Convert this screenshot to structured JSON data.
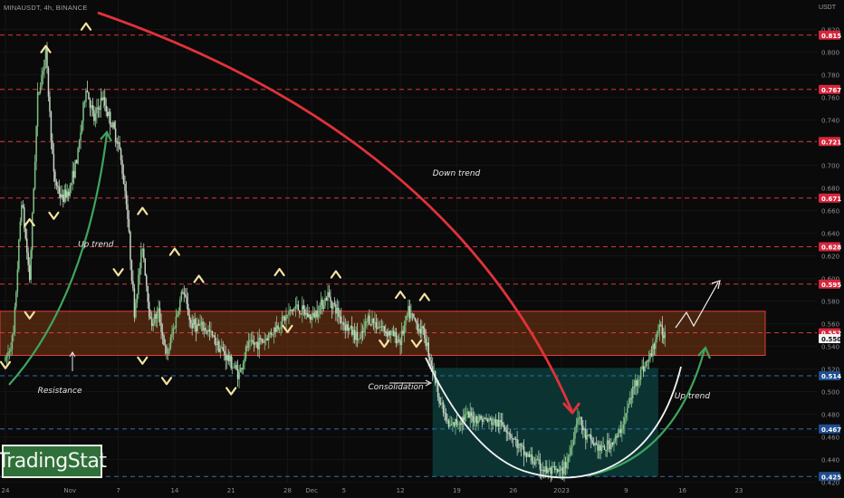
{
  "header": {
    "symbol": "MINAUSDT, 4h, BINANCE",
    "currency": "USDT"
  },
  "logo": {
    "text": "TradingStat"
  },
  "colors": {
    "background": "#0a0a0a",
    "candle_up": "#7fc185",
    "candle_down": "#c6d3c4",
    "resistance_dashed": "#d9383f",
    "support_dashed": "#2f6fb3",
    "zone_fill": "#7b3a14",
    "consolidation_fill": "#0c3b3a",
    "down_trend_arrow": "#e0323a",
    "up_trend_arrow": "#3fa55e",
    "pivot_marker": "#f3e3a2"
  },
  "chart_data": {
    "type": "candlestick",
    "title": "MINAUSDT, 4h, BINANCE",
    "y_unit": "USDT",
    "ylim": [
      0.418,
      0.826
    ],
    "y_ticks": [
      0.42,
      0.44,
      0.46,
      0.48,
      0.5,
      0.52,
      0.54,
      0.56,
      0.58,
      0.6,
      0.62,
      0.64,
      0.66,
      0.68,
      0.7,
      0.72,
      0.74,
      0.76,
      0.78,
      0.8,
      0.82
    ],
    "y_tick_labels": [
      "0.420",
      "0.440",
      "0.460",
      "0.480",
      "0.500",
      "0.520",
      "0.540",
      "0.560",
      "0.580",
      "0.600",
      "0.620",
      "0.640",
      "0.660",
      "0.680",
      "0.700",
      "0.720",
      "0.740",
      "0.760",
      "0.780",
      "0.800",
      "0.820"
    ],
    "x_range": [
      "2022-10-24",
      "2023-01-24"
    ],
    "x_ticks": [
      {
        "date": "2022-10-24",
        "label": "24"
      },
      {
        "date": "2022-11-01",
        "label": "Nov"
      },
      {
        "date": "2022-11-07",
        "label": "7"
      },
      {
        "date": "2022-11-14",
        "label": "14"
      },
      {
        "date": "2022-11-21",
        "label": "21"
      },
      {
        "date": "2022-11-28",
        "label": "28"
      },
      {
        "date": "2022-12-01",
        "label": "Dec"
      },
      {
        "date": "2022-12-05",
        "label": "5"
      },
      {
        "date": "2022-12-12",
        "label": "12"
      },
      {
        "date": "2022-12-19",
        "label": "19"
      },
      {
        "date": "2022-12-26",
        "label": "26"
      },
      {
        "date": "2023-01-01",
        "label": "2023"
      },
      {
        "date": "2023-01-09",
        "label": "9"
      },
      {
        "date": "2023-01-16",
        "label": "16"
      },
      {
        "date": "2023-01-23",
        "label": "23"
      }
    ],
    "price_path": [
      {
        "date": "2022-10-24",
        "price": 0.527
      },
      {
        "date": "2022-10-25",
        "price": 0.55
      },
      {
        "date": "2022-10-26",
        "price": 0.67
      },
      {
        "date": "2022-10-27",
        "price": 0.6
      },
      {
        "date": "2022-10-28",
        "price": 0.76
      },
      {
        "date": "2022-10-29",
        "price": 0.8
      },
      {
        "date": "2022-10-30",
        "price": 0.69
      },
      {
        "date": "2022-10-31",
        "price": 0.67
      },
      {
        "date": "2022-11-01",
        "price": 0.68
      },
      {
        "date": "2022-11-02",
        "price": 0.71
      },
      {
        "date": "2022-11-03",
        "price": 0.77
      },
      {
        "date": "2022-11-04",
        "price": 0.74
      },
      {
        "date": "2022-11-05",
        "price": 0.76
      },
      {
        "date": "2022-11-06",
        "price": 0.74
      },
      {
        "date": "2022-11-07",
        "price": 0.72
      },
      {
        "date": "2022-11-08",
        "price": 0.67
      },
      {
        "date": "2022-11-09",
        "price": 0.57
      },
      {
        "date": "2022-11-10",
        "price": 0.63
      },
      {
        "date": "2022-11-11",
        "price": 0.56
      },
      {
        "date": "2022-11-12",
        "price": 0.57
      },
      {
        "date": "2022-11-13",
        "price": 0.53
      },
      {
        "date": "2022-11-14",
        "price": 0.56
      },
      {
        "date": "2022-11-15",
        "price": 0.59
      },
      {
        "date": "2022-11-16",
        "price": 0.56
      },
      {
        "date": "2022-11-18",
        "price": 0.555
      },
      {
        "date": "2022-11-20",
        "price": 0.535
      },
      {
        "date": "2022-11-22",
        "price": 0.515
      },
      {
        "date": "2022-11-23",
        "price": 0.54
      },
      {
        "date": "2022-11-25",
        "price": 0.545
      },
      {
        "date": "2022-11-27",
        "price": 0.56
      },
      {
        "date": "2022-11-29",
        "price": 0.575
      },
      {
        "date": "2022-12-01",
        "price": 0.565
      },
      {
        "date": "2022-12-03",
        "price": 0.585
      },
      {
        "date": "2022-12-05",
        "price": 0.56
      },
      {
        "date": "2022-12-07",
        "price": 0.545
      },
      {
        "date": "2022-12-08",
        "price": 0.565
      },
      {
        "date": "2022-12-10",
        "price": 0.555
      },
      {
        "date": "2022-12-12",
        "price": 0.545
      },
      {
        "date": "2022-12-13",
        "price": 0.57
      },
      {
        "date": "2022-12-15",
        "price": 0.55
      },
      {
        "date": "2022-12-16",
        "price": 0.52
      },
      {
        "date": "2022-12-17",
        "price": 0.49
      },
      {
        "date": "2022-12-18",
        "price": 0.468
      },
      {
        "date": "2022-12-20",
        "price": 0.478
      },
      {
        "date": "2022-12-22",
        "price": 0.476
      },
      {
        "date": "2022-12-25",
        "price": 0.47
      },
      {
        "date": "2022-12-27",
        "price": 0.448
      },
      {
        "date": "2022-12-30",
        "price": 0.43
      },
      {
        "date": "2023-01-01",
        "price": 0.428
      },
      {
        "date": "2023-01-02",
        "price": 0.445
      },
      {
        "date": "2023-01-03",
        "price": 0.48
      },
      {
        "date": "2023-01-04",
        "price": 0.46
      },
      {
        "date": "2023-01-06",
        "price": 0.448
      },
      {
        "date": "2023-01-08",
        "price": 0.46
      },
      {
        "date": "2023-01-09",
        "price": 0.48
      },
      {
        "date": "2023-01-10",
        "price": 0.505
      },
      {
        "date": "2023-01-11",
        "price": 0.52
      },
      {
        "date": "2023-01-12",
        "price": 0.53
      },
      {
        "date": "2023-01-13",
        "price": 0.555
      },
      {
        "date": "2023-01-14",
        "price": 0.55
      }
    ],
    "horizontal_levels": [
      {
        "price": 0.815,
        "label": "0.815",
        "style": "resistance"
      },
      {
        "price": 0.767,
        "label": "0.767",
        "style": "resistance"
      },
      {
        "price": 0.721,
        "label": "0.721",
        "style": "resistance"
      },
      {
        "price": 0.671,
        "label": "0.671",
        "style": "resistance"
      },
      {
        "price": 0.628,
        "label": "0.628",
        "style": "resistance"
      },
      {
        "price": 0.595,
        "label": "0.595",
        "style": "resistance"
      },
      {
        "price": 0.552,
        "label": "0.552",
        "style": "resistance"
      },
      {
        "price": 0.514,
        "label": "0.514",
        "style": "support"
      },
      {
        "price": 0.467,
        "label": "0.467",
        "style": "support"
      },
      {
        "price": 0.425,
        "label": "0.425",
        "style": "support"
      }
    ],
    "current_price": {
      "price": 0.55,
      "label": "0.550"
    },
    "resistance_zone": {
      "top": 0.571,
      "bottom": 0.532
    },
    "consolidation_zone": {
      "start": "2022-12-16",
      "end": "2023-01-13",
      "top": 0.521,
      "bottom": 0.425
    },
    "annotations": [
      {
        "text": "Down trend",
        "date": "2022-12-16",
        "price": 0.691
      },
      {
        "text": "Up trend",
        "date": "2022-11-02",
        "price": 0.628
      },
      {
        "text": "Resistance",
        "date": "2022-10-28",
        "price": 0.499
      },
      {
        "text": "Consolidation",
        "date": "2022-12-08",
        "price": 0.502
      },
      {
        "text": "Up trend",
        "date": "2023-01-15",
        "price": 0.494
      }
    ],
    "pivot_markers": [
      {
        "date": "2022-10-24",
        "price": 0.523,
        "dir": "down"
      },
      {
        "date": "2022-10-27",
        "price": 0.65,
        "dir": "up"
      },
      {
        "date": "2022-10-27",
        "price": 0.567,
        "dir": "down"
      },
      {
        "date": "2022-10-29",
        "price": 0.803,
        "dir": "up"
      },
      {
        "date": "2022-10-30",
        "price": 0.655,
        "dir": "down"
      },
      {
        "date": "2022-11-03",
        "price": 0.823,
        "dir": "up"
      },
      {
        "date": "2022-11-07",
        "price": 0.605,
        "dir": "down"
      },
      {
        "date": "2022-11-10",
        "price": 0.66,
        "dir": "up"
      },
      {
        "date": "2022-11-10",
        "price": 0.527,
        "dir": "down"
      },
      {
        "date": "2022-11-13",
        "price": 0.509,
        "dir": "down"
      },
      {
        "date": "2022-11-14",
        "price": 0.624,
        "dir": "up"
      },
      {
        "date": "2022-11-17",
        "price": 0.6,
        "dir": "up"
      },
      {
        "date": "2022-11-21",
        "price": 0.5,
        "dir": "down"
      },
      {
        "date": "2022-11-27",
        "price": 0.606,
        "dir": "up"
      },
      {
        "date": "2022-11-28",
        "price": 0.555,
        "dir": "down"
      },
      {
        "date": "2022-12-04",
        "price": 0.604,
        "dir": "up"
      },
      {
        "date": "2022-12-10",
        "price": 0.542,
        "dir": "down"
      },
      {
        "date": "2022-12-12",
        "price": 0.586,
        "dir": "up"
      },
      {
        "date": "2022-12-14",
        "price": 0.542,
        "dir": "down"
      },
      {
        "date": "2022-12-15",
        "price": 0.584,
        "dir": "up"
      }
    ]
  }
}
